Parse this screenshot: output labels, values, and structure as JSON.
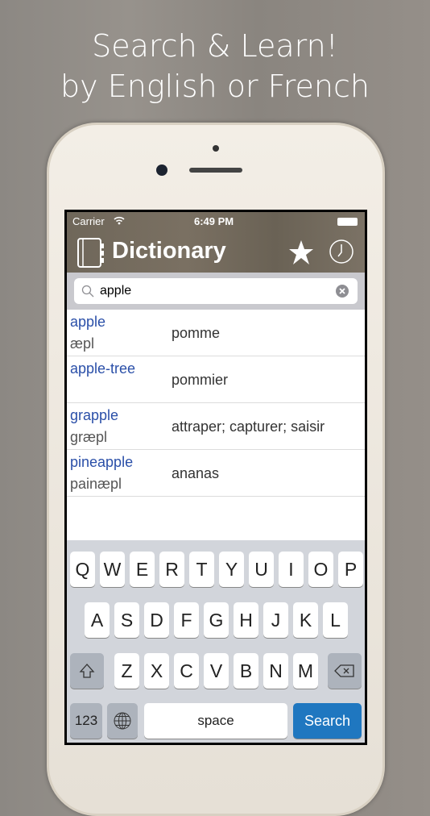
{
  "headline": {
    "line1": "Search & Learn!",
    "line2": "by English or French"
  },
  "status": {
    "carrier": "Carrier",
    "time": "6:49 PM"
  },
  "nav": {
    "title": "Dictionary",
    "icons": [
      "book-icon",
      "star-icon",
      "clock-icon"
    ]
  },
  "search": {
    "value": "apple"
  },
  "results": [
    {
      "word": "apple",
      "phonetic": "æpl",
      "translation": "pomme"
    },
    {
      "word": "apple-tree",
      "phonetic": "",
      "translation": "pommier"
    },
    {
      "word": "grapple",
      "phonetic": "græpl",
      "translation": "attraper; capturer; saisir"
    },
    {
      "word": "pineapple",
      "phonetic": "painæpl",
      "translation": "ananas"
    }
  ],
  "keyboard": {
    "row1": [
      "Q",
      "W",
      "E",
      "R",
      "T",
      "Y",
      "U",
      "I",
      "O",
      "P"
    ],
    "row2": [
      "A",
      "S",
      "D",
      "F",
      "G",
      "H",
      "J",
      "K",
      "L"
    ],
    "row3": [
      "Z",
      "X",
      "C",
      "V",
      "B",
      "N",
      "M"
    ],
    "numbers": "123",
    "space": "space",
    "search": "Search"
  },
  "colors": {
    "accent": "#1f77c0",
    "word": "#2a4fa8"
  }
}
